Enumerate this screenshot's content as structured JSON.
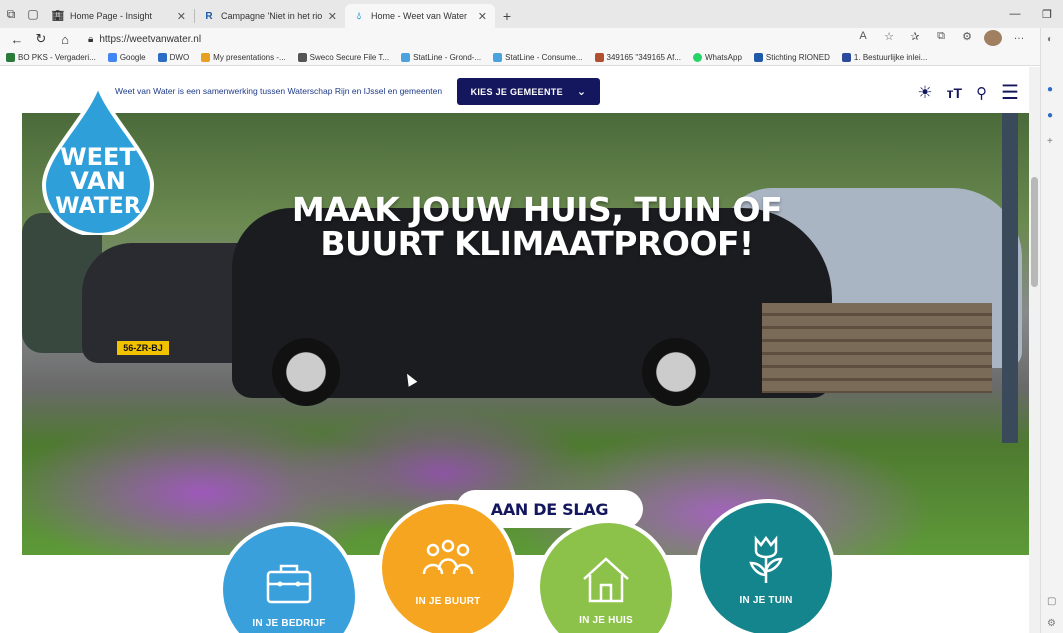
{
  "browser": {
    "tabs": [
      {
        "title": "Home Page - Insight",
        "icon": "building-icon",
        "active": false
      },
      {
        "title": "Campagne 'Niet in het riool' - RI",
        "icon": "R-icon",
        "active": false
      },
      {
        "title": "Home - Weet van Water",
        "icon": "water-drop-icon",
        "active": true
      }
    ],
    "url": "https://weetvanwater.nl",
    "bookmarks": [
      "BO PKS - Vergaderi...",
      "Google",
      "DWO",
      "My presentations -...",
      "Sweco Secure File T...",
      "StatLine - Grond-...",
      "StatLine - Consume...",
      "349165 \"349165 Af...",
      "WhatsApp",
      "Stichting RIONED",
      "1. Bestuurlijke inlei..."
    ]
  },
  "site": {
    "intro_text": "Weet van Water is een samenwerking tussen Waterschap Rijn en IJssel en gemeenten",
    "kies_button": "KIES JE GEMEENTE",
    "logo_lines": [
      "WEET",
      "VAN",
      "WATER"
    ],
    "hero_title": "MAAK JOUW HUIS, TUIN OF BUURT KLIMAATPROOF!",
    "cta_label": "AAN DE SLAG",
    "license_plate": "56-ZR-BJ",
    "categories": [
      {
        "label": "IN JE BEDRIJF",
        "icon": "briefcase-icon",
        "color": "#3aa0dc"
      },
      {
        "label": "IN JE BUURT",
        "icon": "people-icon",
        "color": "#f5a51f"
      },
      {
        "label": "IN JE HUIS",
        "icon": "house-icon",
        "color": "#8cc24a"
      },
      {
        "label": "IN JE TUIN",
        "icon": "tulip-icon",
        "color": "#14858c"
      }
    ]
  },
  "colors": {
    "navy": "#14175e",
    "logo_blue": "#2f9fd9"
  }
}
